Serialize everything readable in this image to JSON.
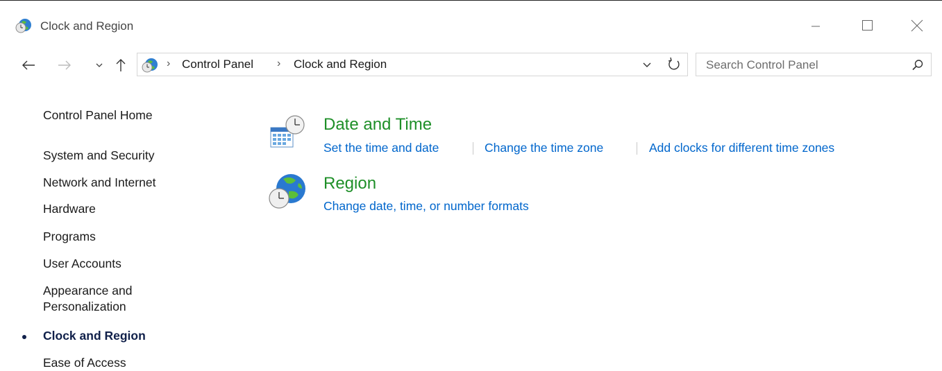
{
  "window": {
    "title": "Clock and Region"
  },
  "address_bar": {
    "breadcrumbs": [
      "Control Panel",
      "Clock and Region"
    ]
  },
  "search": {
    "placeholder": "Search Control Panel"
  },
  "sidebar": {
    "home": "Control Panel Home",
    "items": [
      {
        "label": "System and Security"
      },
      {
        "label": "Network and Internet"
      },
      {
        "label": "Hardware"
      },
      {
        "label": "Programs"
      },
      {
        "label": "User Accounts"
      },
      {
        "label": "Appearance and Personalization",
        "line1": "Appearance and",
        "line2": "Personalization"
      },
      {
        "label": "Clock and Region",
        "current": true
      },
      {
        "label": "Ease of Access"
      }
    ]
  },
  "main": {
    "categories": [
      {
        "title": "Date and Time",
        "icon": "date-time-icon",
        "tasks": [
          "Set the time and date",
          "Change the time zone",
          "Add clocks for different time zones"
        ]
      },
      {
        "title": "Region",
        "icon": "region-globe-icon",
        "tasks": [
          "Change date, time, or number formats"
        ]
      }
    ]
  },
  "colors": {
    "category_title": "#1e8f28",
    "link": "#0066cc",
    "current_nav": "#10204a"
  }
}
